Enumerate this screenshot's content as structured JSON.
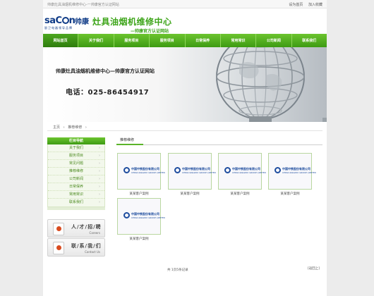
{
  "topbar": {
    "site_desc": "帅康灶具油烟机维修中心-一帅康官方认证网站",
    "set_home": "设为首页",
    "add_favorite": "加入收藏"
  },
  "header": {
    "logo_word": "saC",
    "logo_word_end": "n",
    "logo_cn": "帅康",
    "logo_sub": "厨卫电器领导品牌",
    "brand_title": "灶具油烟机维修中心",
    "brand_sub": "—帅康官方认证网站"
  },
  "nav": {
    "items": [
      "网站首页",
      "关于我们",
      "服务项目",
      "服务项目",
      "日常保养",
      "常用常识",
      "公司新闻",
      "联系我们"
    ]
  },
  "banner": {
    "title": "帅康灶具油烟机维修中心—帅康官方认证网站",
    "phone": "电话：025-86454917"
  },
  "breadcrumb": {
    "home": "主页",
    "sep": "›",
    "current": "推荐维修",
    "sep2": "›"
  },
  "sidebar": {
    "title": "栏目导航",
    "items": [
      "关于我们",
      "服务项目",
      "常见问题",
      "推荐维修",
      "公司新闻",
      "日常保养",
      "常用常识",
      "联系我们"
    ],
    "arrow": "›"
  },
  "promos": {
    "careers": {
      "title": "人/才/招/聘",
      "sub": "Careers"
    },
    "contact": {
      "title": "联/系/我/们",
      "sub": "Contact Us"
    }
  },
  "main": {
    "title": "推荐维修",
    "card_company": "中国中铁股份有限公司",
    "card_company_en": "CHINA RAILWAY GROUP LIMITED",
    "caption": "某某客户案例"
  },
  "pager": {
    "info": "共 1页5条记录",
    "back": "[返回上]"
  },
  "colors": {
    "accent_green": "#3ea51a",
    "brand_blue": "#0f3b87"
  }
}
